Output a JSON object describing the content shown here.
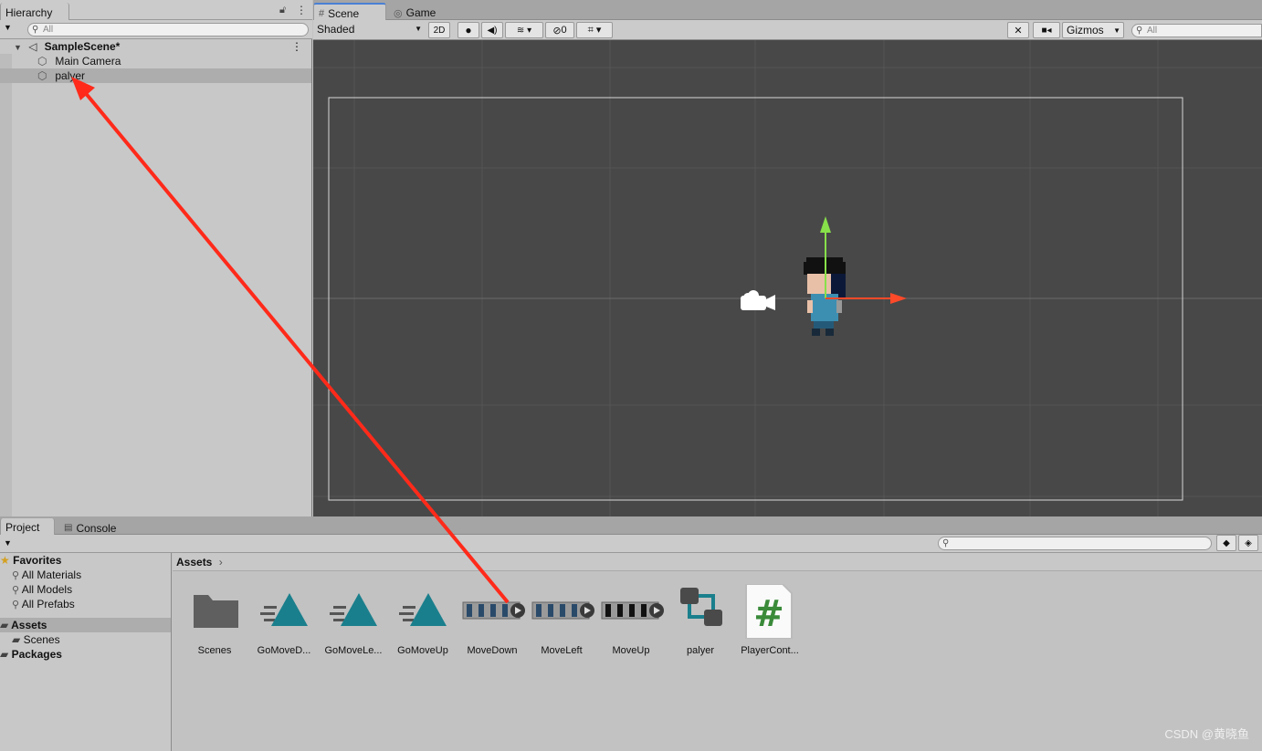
{
  "hierarchy": {
    "tab": "Hierarchy",
    "search_placeholder": "All",
    "scene": "SampleScene*",
    "items": [
      {
        "label": "Main Camera"
      },
      {
        "label": "palyer"
      }
    ]
  },
  "scene_view": {
    "tabs": [
      {
        "label": "Scene"
      },
      {
        "label": "Game"
      }
    ],
    "shading_mode": "Shaded",
    "mode_2d": "2D",
    "hidden_count": "0",
    "gizmos": "Gizmos",
    "search_placeholder": "All"
  },
  "project": {
    "tabs": [
      {
        "label": "Project"
      },
      {
        "label": "Console"
      }
    ],
    "favorites": {
      "label": "Favorites",
      "items": [
        "All Materials",
        "All Models",
        "All Prefabs"
      ]
    },
    "assets_root": "Assets",
    "assets_children": [
      "Scenes"
    ],
    "packages": "Packages",
    "breadcrumb": "Assets",
    "assets": [
      {
        "label": "Scenes",
        "kind": "folder-icon"
      },
      {
        "label": "GoMoveD...",
        "kind": "animation-clip-icon"
      },
      {
        "label": "GoMoveLe...",
        "kind": "animation-clip-icon"
      },
      {
        "label": "GoMoveUp",
        "kind": "animation-clip-icon"
      },
      {
        "label": "MoveDown",
        "kind": "sprite-sheet-icon"
      },
      {
        "label": "MoveLeft",
        "kind": "sprite-sheet-icon"
      },
      {
        "label": "MoveUp",
        "kind": "sprite-sheet-icon"
      },
      {
        "label": "palyer",
        "kind": "animator-controller-icon"
      },
      {
        "label": "PlayerCont...",
        "kind": "csharp-script-icon"
      }
    ]
  },
  "watermark": "CSDN @黄晓鱼",
  "colors": {
    "viewport_bg": "#484848",
    "gizmo_x": "#ff4a2a",
    "gizmo_y": "#88e04a",
    "annotation_arrow": "#ff2a1a",
    "anim_icon": "#1a7f8c",
    "script_icon": "#3a8a3a"
  }
}
